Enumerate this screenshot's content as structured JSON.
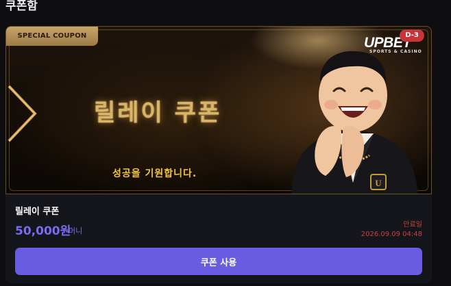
{
  "page": {
    "title": "쿠폰함"
  },
  "coupon": {
    "badge": "SPECIAL COUPON",
    "banner_title": "릴레이 쿠폰",
    "banner_subtitle": "성공을 기원합니다.",
    "brand": {
      "logo": "UPBET",
      "sub": "SPORTS & CASINO"
    },
    "dday": "D-3",
    "name": "릴레이 쿠폰",
    "amount": "50,000원",
    "unit": "머니",
    "expiry_label": "만료일",
    "expiry_date": "2026.09.09 04:48",
    "use_button_label": "쿠폰 사용"
  },
  "colors": {
    "background": "#0e0e11",
    "accent": "#6a5ce0",
    "amount": "#7a6cf0",
    "expiry": "#c94141",
    "gold": "#d8b56a"
  }
}
